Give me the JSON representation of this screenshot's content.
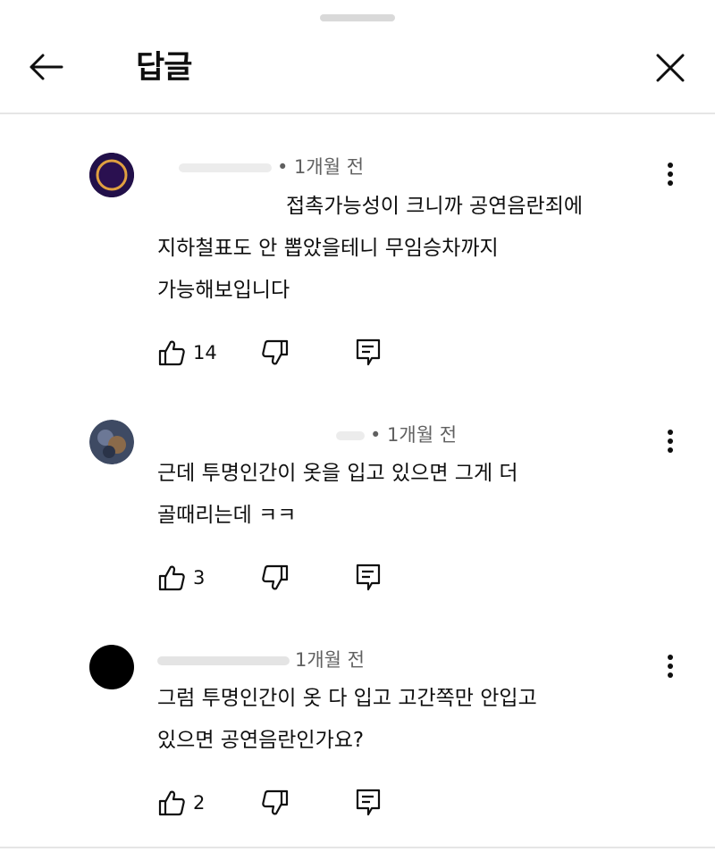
{
  "header": {
    "title": "답글"
  },
  "comments": [
    {
      "author": "",
      "time": "• 1개월 전",
      "text": "접촉가능성이 크니까 공연음란죄에 지하철표도 안 뽑았을테니 무임승차까지 가능해보입니다",
      "line1": "접촉가능성이 크니까 공연음란죄에",
      "line2": "지하철표도 안 뽑았을테니 무임승차까지",
      "line3": "가능해보입니다",
      "likes": "14"
    },
    {
      "author": "",
      "time": "• 1개월 전",
      "line1": "근데 투명인간이 옷을 입고 있으면 그게 더",
      "line2": "골때리는데 ㅋㅋ",
      "likes": "3"
    },
    {
      "author": "",
      "time": "1개월 전",
      "line1": "그럼 투명인간이 옷 다 입고 고간쪽만 안입고",
      "line2": "있으면 공연음란인가요?",
      "likes": "2"
    }
  ],
  "icons": {
    "back": "arrow-left-icon",
    "close": "close-icon",
    "more": "more-vert-icon",
    "like": "thumbs-up-icon",
    "dislike": "thumbs-down-icon",
    "reply": "reply-icon"
  },
  "colors": {
    "text": "#0f0f0f",
    "secondary": "#606060",
    "divider": "#e5e5e5"
  }
}
